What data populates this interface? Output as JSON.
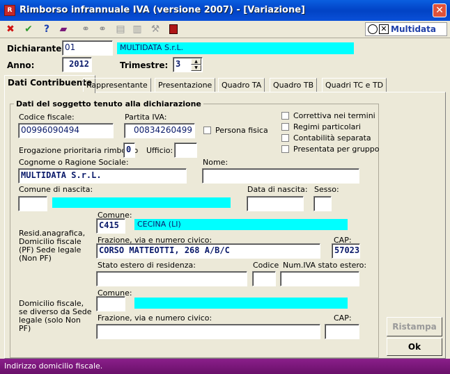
{
  "window": {
    "title": "Rimborso infrannuale IVA (versione 2007) - [Variazione]",
    "close": "✕"
  },
  "brand": {
    "name": "Multidata"
  },
  "header": {
    "dichiarante_label": "Dichiarante:",
    "dichiarante_code": "01",
    "dichiarante_name": "MULTIDATA S.r.L.",
    "anno_label": "Anno:",
    "anno_value": "2012",
    "trimestre_label": "Trimestre:",
    "trimestre_value": "3"
  },
  "tabs": [
    {
      "label": "Dati Contribuente"
    },
    {
      "label": "Rappresentante"
    },
    {
      "label": "Presentazione"
    },
    {
      "label": "Quadro TA"
    },
    {
      "label": "Quadro TB"
    },
    {
      "label": "Quadri TC e TD"
    }
  ],
  "group": {
    "title": "Dati del soggetto tenuto alla dichiarazione",
    "codice_fiscale_label": "Codice fiscale:",
    "codice_fiscale": "00996090494",
    "partita_iva_label": "Partita IVA:",
    "partita_iva": "00834260499",
    "persona_fisica": "Persona fisica",
    "erogazione_label": "Erogazione prioritaria rimborso",
    "erogazione_value": "0",
    "ufficio_label": "Ufficio:",
    "cognome_label": "Cognome o Ragione Sociale:",
    "cognome_value": "MULTIDATA S.r.L.",
    "nome_label": "Nome:",
    "comune_nascita_label": "Comune di nascita:",
    "data_nascita_label": "Data di nascita:",
    "sesso_label": "Sesso:",
    "resid_label": "Resid.anagrafica, Domicilio fiscale (PF) Sede legale (Non PF)",
    "comune_label": "Comune:",
    "comune_code": "C415",
    "comune_name": "CECINA (LI)",
    "via_label": "Frazione, via e numero civico:",
    "via_value": "CORSO MATTEOTTI, 268 A/B/C",
    "cap_label": "CAP:",
    "cap_value": "57023",
    "stato_estero_label": "Stato estero di residenza:",
    "codice_label": "Codice",
    "num_iva_label": "Num.IVA stato estero:",
    "domicilio_label": "Domicilio fiscale, se diverso da Sede legale (solo Non PF)",
    "comune2_label": "Comune:",
    "via2_label": "Frazione, via e numero civico:",
    "cap2_label": "CAP:"
  },
  "options": [
    {
      "label": "Correttiva nei termini"
    },
    {
      "label": "Regimi particolari"
    },
    {
      "label": "Contabilità separata"
    },
    {
      "label": "Presentata per gruppo"
    }
  ],
  "buttons": {
    "ristampa": "Ristampa",
    "ok": "Ok"
  },
  "status": {
    "text": "Indirizzo domicilio fiscale."
  }
}
